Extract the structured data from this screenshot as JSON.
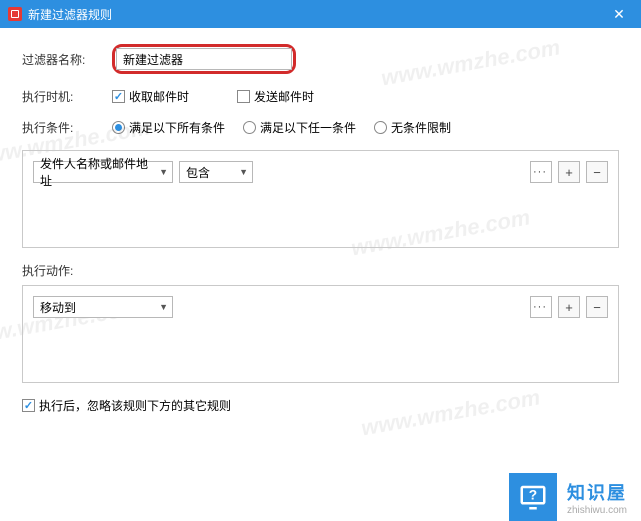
{
  "titlebar": {
    "title": "新建过滤器规则"
  },
  "form": {
    "name_label": "过滤器名称:",
    "name_value": "新建过滤器",
    "timing_label": "执行时机:",
    "timing": {
      "receive": {
        "label": "收取邮件时",
        "checked": true
      },
      "send": {
        "label": "发送邮件时",
        "checked": false
      }
    },
    "cond_label": "执行条件:",
    "cond": {
      "all": {
        "label": "满足以下所有条件",
        "checked": true
      },
      "any": {
        "label": "满足以下任一条件",
        "checked": false
      },
      "none": {
        "label": "无条件限制",
        "checked": false
      }
    }
  },
  "condition_row": {
    "field": "发件人名称或邮件地址",
    "operator": "包含",
    "more": "···",
    "add": "+",
    "remove": "−"
  },
  "action": {
    "label": "执行动作:",
    "value": "移动到",
    "more": "···",
    "add": "+",
    "remove": "−"
  },
  "footer": {
    "skip_label": "执行后，忽略该规则下方的其它规则",
    "skip_checked": true
  },
  "brand": {
    "name": "知识屋",
    "domain": "zhishiwu.com"
  },
  "watermark": "www.wmzhe.com"
}
